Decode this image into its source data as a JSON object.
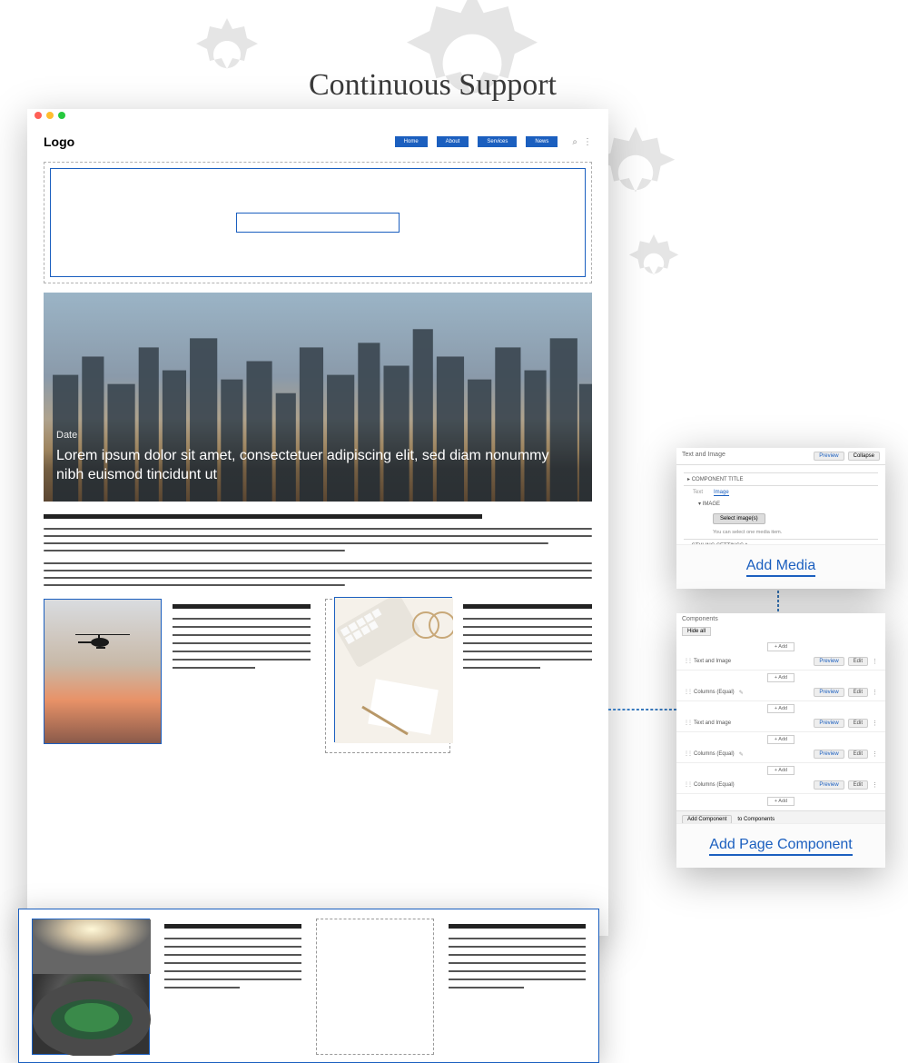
{
  "title": "Continuous Support",
  "browser": {
    "logo": "Logo",
    "nav": [
      "Home",
      "About",
      "Services",
      "News"
    ],
    "hero": {
      "date": "Date",
      "text": "Lorem ipsum dolor sit amet, consectetuer adipiscing elit, sed diam nonummy nibh euismod tincidunt ut"
    }
  },
  "media_panel": {
    "header_label": "Text and Image",
    "preview_btn": "Preview",
    "collapse_btn": "Collapse",
    "section_title": "COMPONENT TITLE",
    "tab_text": "Text",
    "tab_image": "Image",
    "image_label": "IMAGE",
    "select_btn": "Select image(s)",
    "hint": "You can select one media item.",
    "styling": "STYLING SETTINGS *",
    "footer_link": "Add Media"
  },
  "components_panel": {
    "header": "Components",
    "hide_all": "Hide all",
    "add_label": "+ Add",
    "rows": [
      {
        "name": "Text and Image"
      },
      {
        "name": "Columns (Equal)"
      },
      {
        "name": "Text and Image"
      },
      {
        "name": "Columns (Equal)"
      },
      {
        "name": "Columns (Equal)"
      }
    ],
    "preview_btn": "Preview",
    "edit_btn": "Edit",
    "add_component_btn": "Add Component",
    "add_component_to": "to Components",
    "footer_link": "Add Page Component"
  }
}
